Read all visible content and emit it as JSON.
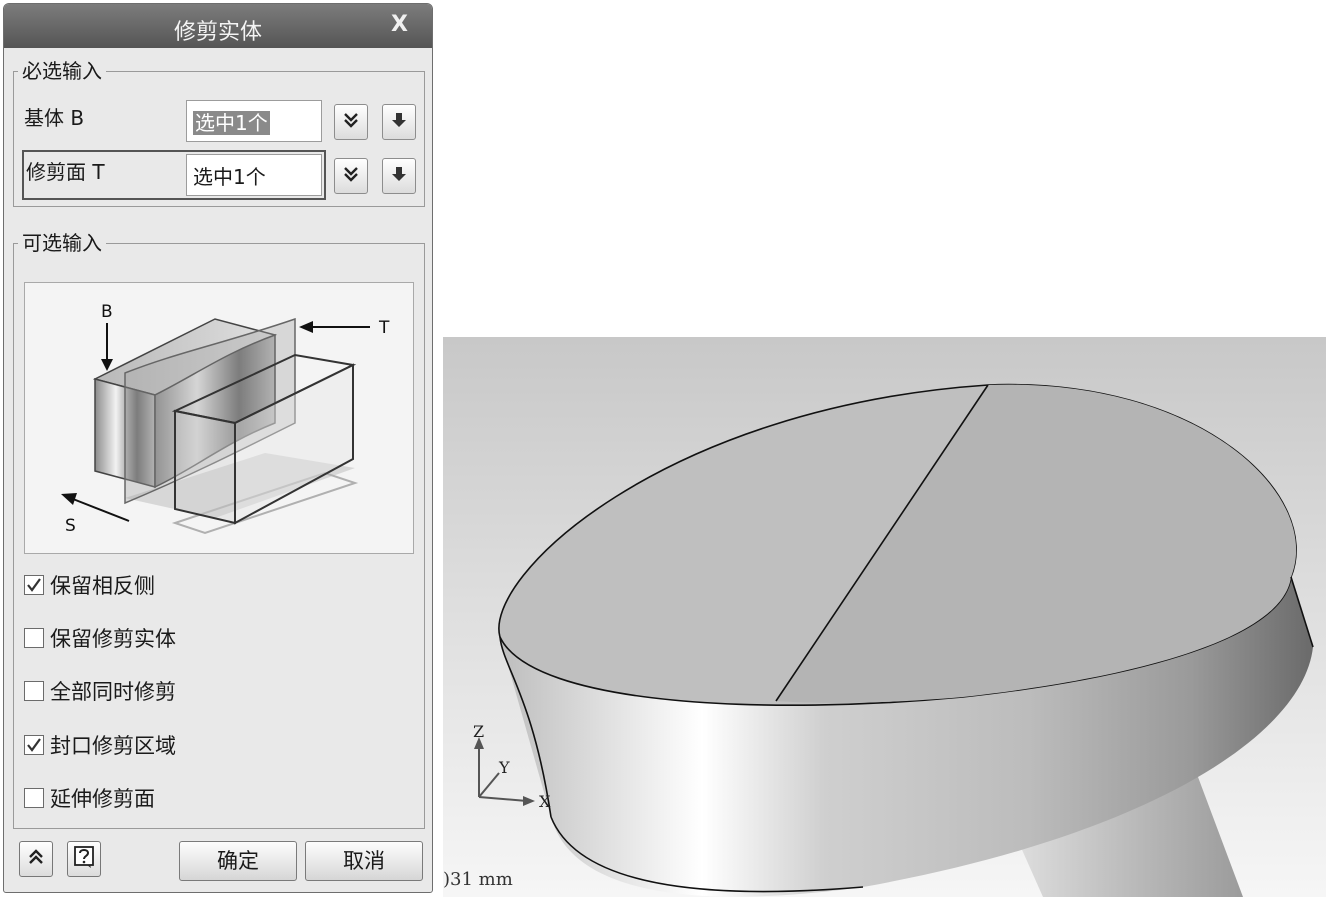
{
  "dialog": {
    "title": "修剪实体",
    "close_label": "X",
    "required_group": {
      "legend": "必选输入",
      "base_label": "基体 B",
      "base_value": "选中1个",
      "trim_label": "修剪面 T",
      "trim_value": "选中1个"
    },
    "optional_group": {
      "legend": "可选输入",
      "diagram_labels": {
        "b": "B",
        "t": "T",
        "s": "S"
      },
      "options": [
        {
          "label": "保留相反侧",
          "checked": true
        },
        {
          "label": "保留修剪实体",
          "checked": false
        },
        {
          "label": "全部同时修剪",
          "checked": false
        },
        {
          "label": "封口修剪区域",
          "checked": true
        },
        {
          "label": "延伸修剪面",
          "checked": false
        }
      ]
    },
    "buttons": {
      "ok": "确定",
      "cancel": "取消"
    }
  },
  "viewport": {
    "axis_labels": {
      "z": "Z",
      "y": "Y",
      "x": "X"
    },
    "scale_text": ")31  mm"
  }
}
